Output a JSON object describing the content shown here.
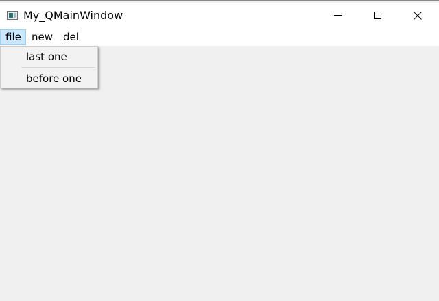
{
  "window": {
    "title": "My_QMainWindow",
    "controls": {
      "minimize_icon": "minimize-icon",
      "maximize_icon": "maximize-icon",
      "close_icon": "close-icon"
    }
  },
  "menubar": {
    "items": [
      {
        "label": "file",
        "active": true
      },
      {
        "label": "new",
        "active": false
      },
      {
        "label": "del",
        "active": false
      }
    ]
  },
  "dropdown": {
    "items": [
      {
        "label": "last one"
      },
      {
        "label": "before one"
      }
    ]
  },
  "colors": {
    "menu_highlight": "#cce8ff",
    "menu_highlight_border": "#99d1ff",
    "client_background": "#f0f0f0"
  }
}
